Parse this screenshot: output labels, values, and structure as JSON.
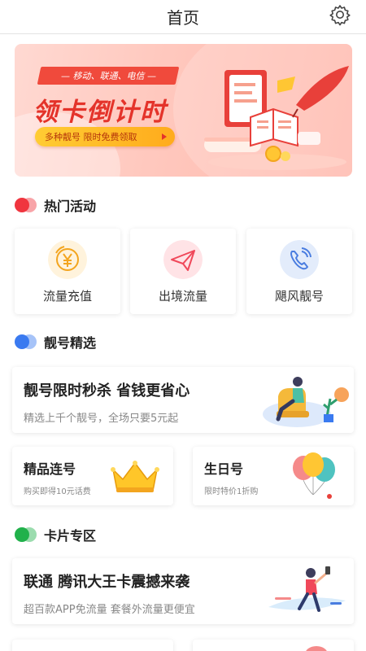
{
  "header": {
    "title": "首页",
    "settings_icon": "gear-icon"
  },
  "banner": {
    "ribbon": "— 移动、联通、电信 —",
    "title": "领卡倒计时",
    "button": "多种靓号  限时免费领取"
  },
  "hot": {
    "title": "热门活动",
    "dot_color": "#f0353f",
    "items": [
      {
        "label": "流量充值",
        "icon": "yen-coin-icon",
        "color": "#f3a51f"
      },
      {
        "label": "出境流量",
        "icon": "paper-plane-icon",
        "color": "#f0485a"
      },
      {
        "label": "飓风靓号",
        "icon": "phone-call-icon",
        "color": "#4a7de0"
      }
    ]
  },
  "numbers": {
    "title": "靓号精选",
    "dot_color": "#3a7af0",
    "promo": {
      "title": "靓号限时秒杀 省钱更省心",
      "subtitle": "精选上千个靓号，全场只要5元起"
    },
    "cards": [
      {
        "title": "精品连号",
        "subtitle": "购买即得10元话费",
        "icon": "crown-icon"
      },
      {
        "title": "生日号",
        "subtitle": "限时特价1折购",
        "icon": "balloons-icon"
      }
    ]
  },
  "cards": {
    "title": "卡片专区",
    "dot_color": "#21b14b",
    "promo": {
      "title": "联通 腾讯大王卡震撼来袭",
      "subtitle": "超百款APP免流量 套餐外流量更便宜"
    }
  }
}
